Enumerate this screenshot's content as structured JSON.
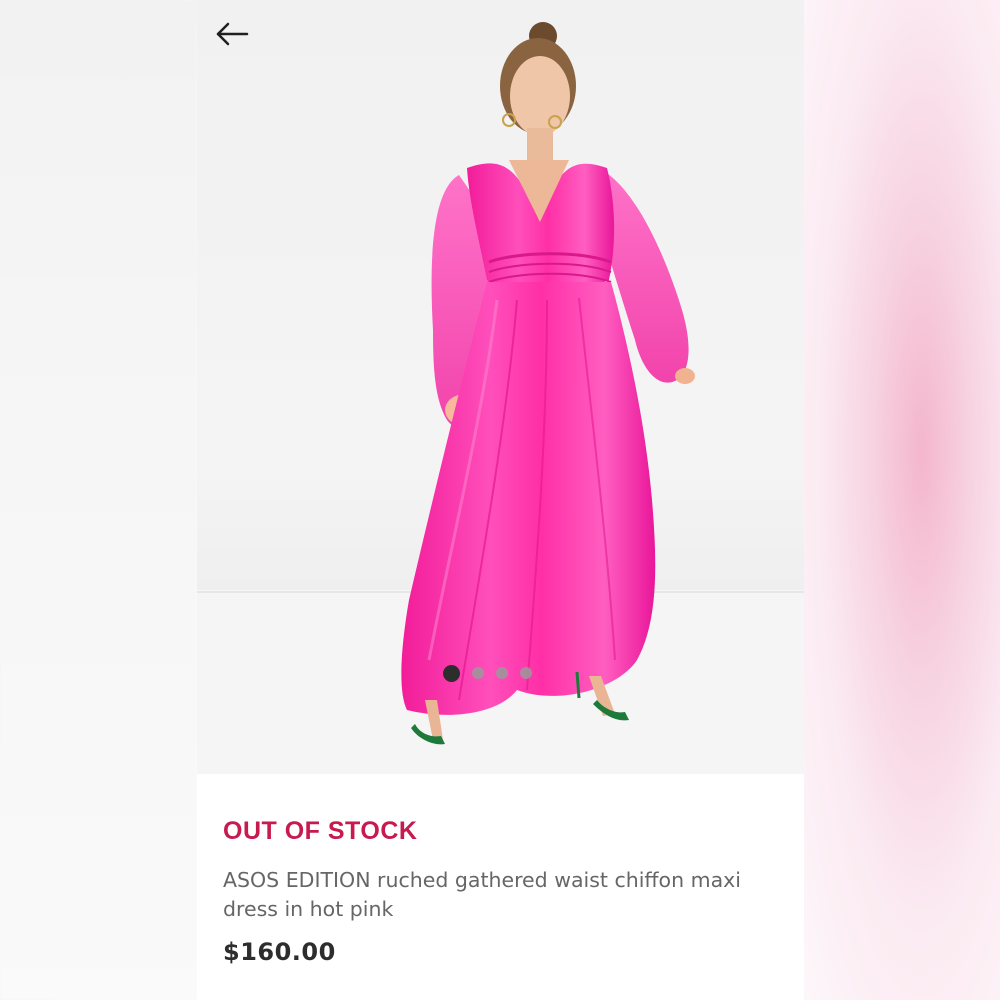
{
  "product": {
    "stock_status": "OUT OF STOCK",
    "title": "ASOS EDITION ruched gathered waist chiffon maxi dress in hot pink",
    "price": "$160.00"
  },
  "gallery": {
    "image_count": 4,
    "active_index": 0
  },
  "icons": {
    "back": "arrow-left-icon"
  },
  "colors": {
    "stock_status": "#c71a4f",
    "dress": "#ff3db0",
    "shoes": "#1e7a3a",
    "active_dot": "#2d2d2d",
    "inactive_dot": "#9a9a9a"
  }
}
